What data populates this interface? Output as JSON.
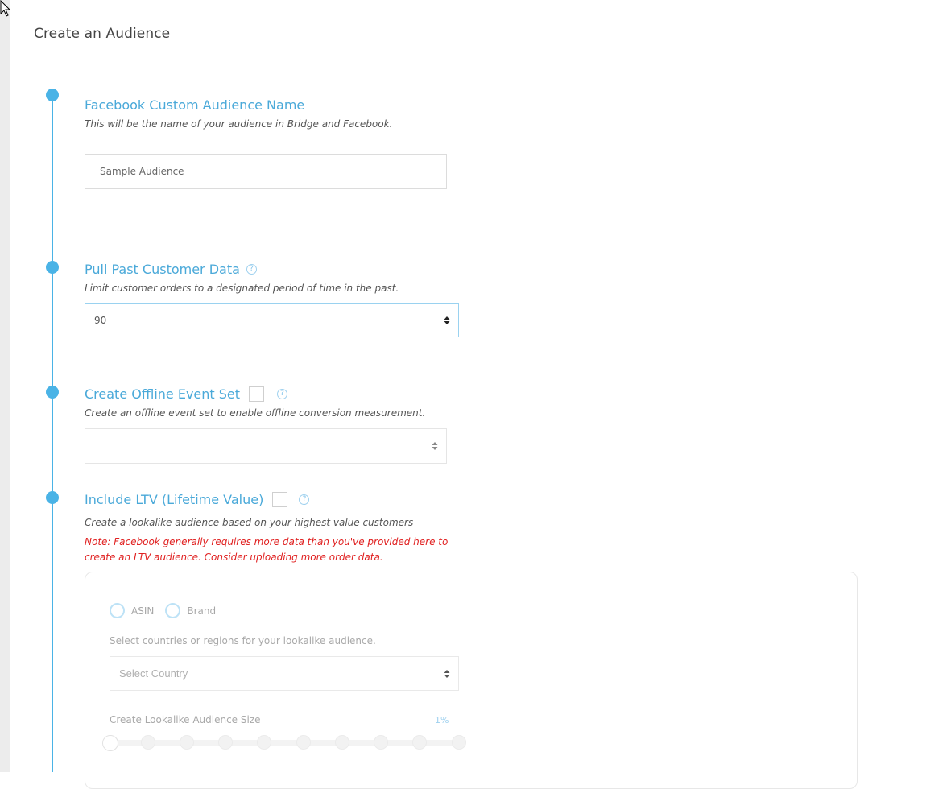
{
  "page": {
    "title": "Create an Audience"
  },
  "steps": {
    "audience_name": {
      "title": "Facebook Custom Audience Name",
      "description": "This will be the name of your audience in Bridge and Facebook.",
      "input_value": "Sample Audience"
    },
    "pull_past_data": {
      "title": "Pull Past Customer Data",
      "description": "Limit customer orders to a designated period of time in the past.",
      "selected_value": "90",
      "help_icon": "question-circle-icon"
    },
    "offline_event_set": {
      "title": "Create Offline Event Set",
      "description": "Create an offline event set to enable offline conversion measurement.",
      "checked": false,
      "selected_value": "",
      "help_icon": "question-circle-icon"
    },
    "include_ltv": {
      "title": "Include LTV (Lifetime Value)",
      "description": "Create a lookalike audience based on your highest value customers",
      "note": "Note: Facebook generally requires more data than you've provided here to create an LTV audience. Consider uploading more order data.",
      "checked": false,
      "help_icon": "question-circle-icon",
      "panel": {
        "radio_options": [
          "ASIN",
          "Brand"
        ],
        "countries_hint": "Select countries or regions for your lookalike audience.",
        "country_placeholder": "Select Country",
        "size_label": "Create Lookalike Audience Size",
        "size_value": "1%"
      }
    }
  },
  "colors": {
    "accent": "#4ab3e6",
    "note": "#e02020"
  }
}
